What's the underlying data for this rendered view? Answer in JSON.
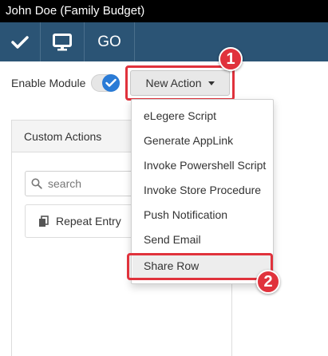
{
  "window": {
    "title": "John Doe (Family Budget)"
  },
  "toolbar": {
    "buttons": [
      {
        "icon": "checkmark-icon"
      },
      {
        "icon": "monitor-icon"
      },
      {
        "label": "GO"
      }
    ]
  },
  "module": {
    "enable_label": "Enable Module",
    "enabled": true
  },
  "new_action": {
    "label": "New Action"
  },
  "annotations": {
    "badge1": "1",
    "badge2": "2"
  },
  "panel": {
    "header": "Custom Actions",
    "search_placeholder": "search",
    "items": [
      {
        "label": "Repeat Entry",
        "icon": "copy-icon"
      }
    ]
  },
  "dropdown": {
    "items": [
      {
        "label": "eLegere Script"
      },
      {
        "label": "Generate AppLink"
      },
      {
        "label": "Invoke Powershell Script"
      },
      {
        "label": "Invoke Store Procedure"
      },
      {
        "label": "Push Notification"
      },
      {
        "label": "Send Email"
      },
      {
        "label": "Share Row"
      }
    ],
    "highlighted": "Share Row"
  },
  "colors": {
    "toolbar": "#2b5475",
    "accent": "#2a7bd6",
    "annotation": "#e0323c"
  }
}
